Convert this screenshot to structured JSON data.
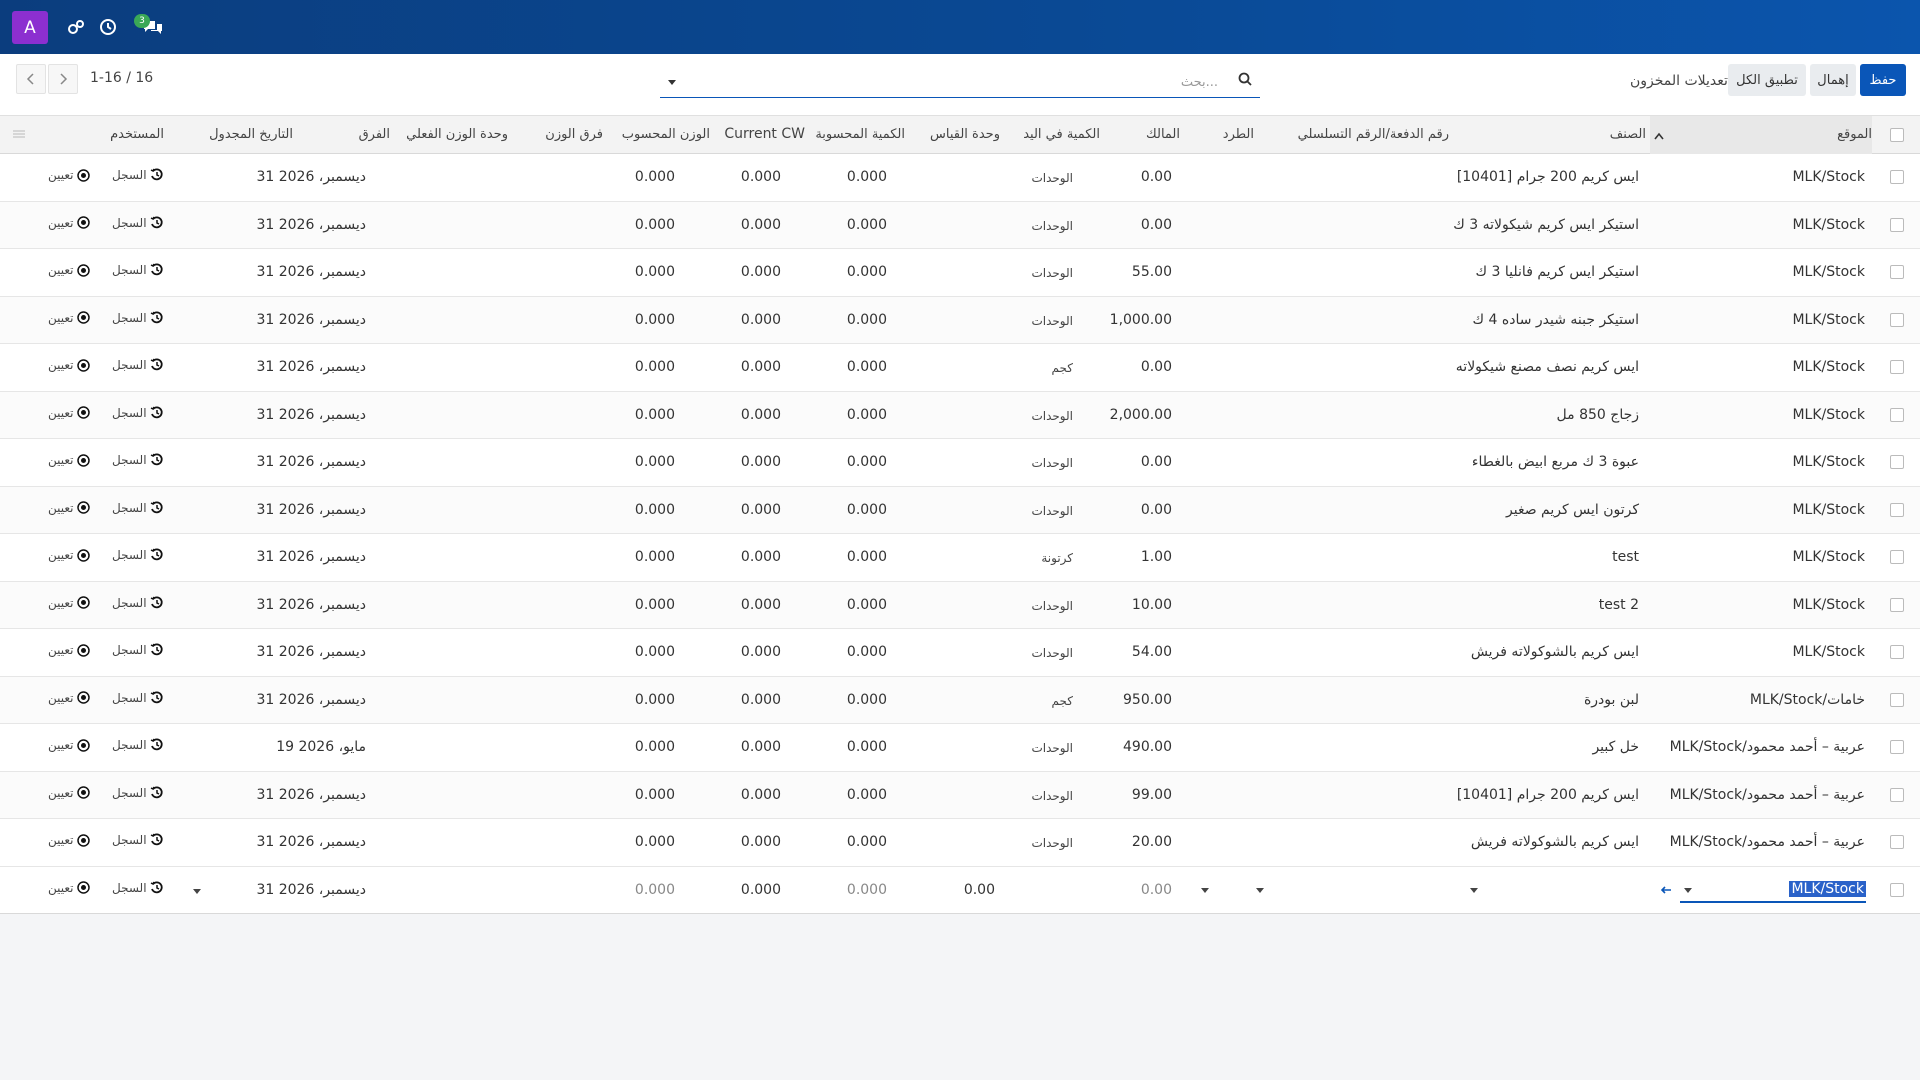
{
  "navbar": {
    "avatar_letter": "A",
    "messages_badge": "3",
    "icons": [
      "settings-cog-icon",
      "clock-icon",
      "chat-icon"
    ]
  },
  "control": {
    "save_label": "حفظ",
    "discard_label": "إهمال",
    "apply_all_label": "تطبيق الكل",
    "title": "تعديلات المخزون",
    "search_placeholder": "بحث...",
    "pager": "1-16 / 16"
  },
  "columns": {
    "location": "الموقع",
    "product": "الصنف",
    "lot": "رقم الدفعة/الرقم التسلسلي",
    "package": "الطرد",
    "owner": "المالك",
    "on_hand": "الكمية في اليد",
    "uom": "وحدة القياس",
    "counted": "الكمية المحسوبة",
    "current_cw": "Current CW",
    "computed_weight": "الوزن المحسوب",
    "weight_diff": "فرق الوزن",
    "actual_weight_uom": "وحدة الوزن الفعلي",
    "difference": "الفرق",
    "scheduled_date": "التاريخ المجدول",
    "user": "المستخدم"
  },
  "actions": {
    "history": "السجل",
    "set": "تعيين"
  },
  "rows": [
    {
      "location": "MLK/Stock",
      "product": "[10401] ايس كريم 200 جرام",
      "on_hand": "0.00",
      "uom": "الوحدات",
      "current_cw": "0.000",
      "computed_weight": "0.000",
      "weight_diff": "0.000",
      "date": "31 ديسمبر، 2026"
    },
    {
      "location": "MLK/Stock",
      "product": "استيكر ايس كريم شيكولاته 3 ك",
      "on_hand": "0.00",
      "uom": "الوحدات",
      "current_cw": "0.000",
      "computed_weight": "0.000",
      "weight_diff": "0.000",
      "date": "31 ديسمبر، 2026"
    },
    {
      "location": "MLK/Stock",
      "product": "استيكر ايس كريم فانليا 3 ك",
      "on_hand": "55.00",
      "uom": "الوحدات",
      "current_cw": "0.000",
      "computed_weight": "0.000",
      "weight_diff": "0.000",
      "date": "31 ديسمبر، 2026"
    },
    {
      "location": "MLK/Stock",
      "product": "استيكر جبنه شيدر ساده 4 ك",
      "on_hand": "1,000.00",
      "uom": "الوحدات",
      "current_cw": "0.000",
      "computed_weight": "0.000",
      "weight_diff": "0.000",
      "date": "31 ديسمبر، 2026"
    },
    {
      "location": "MLK/Stock",
      "product": "ايس كريم نصف مصنع شيكولاته",
      "on_hand": "0.00",
      "uom": "كجم",
      "current_cw": "0.000",
      "computed_weight": "0.000",
      "weight_diff": "0.000",
      "date": "31 ديسمبر، 2026"
    },
    {
      "location": "MLK/Stock",
      "product": "زجاج 850 مل",
      "on_hand": "2,000.00",
      "uom": "الوحدات",
      "current_cw": "0.000",
      "computed_weight": "0.000",
      "weight_diff": "0.000",
      "date": "31 ديسمبر، 2026"
    },
    {
      "location": "MLK/Stock",
      "product": "عبوة 3 ك مربع ابيض بالغطاء",
      "on_hand": "0.00",
      "uom": "الوحدات",
      "current_cw": "0.000",
      "computed_weight": "0.000",
      "weight_diff": "0.000",
      "date": "31 ديسمبر، 2026"
    },
    {
      "location": "MLK/Stock",
      "product": "كرتون ايس كريم صغير",
      "on_hand": "0.00",
      "uom": "الوحدات",
      "current_cw": "0.000",
      "computed_weight": "0.000",
      "weight_diff": "0.000",
      "date": "31 ديسمبر، 2026"
    },
    {
      "location": "MLK/Stock",
      "product": "test",
      "on_hand": "1.00",
      "uom": "كرتونة",
      "current_cw": "0.000",
      "computed_weight": "0.000",
      "weight_diff": "0.000",
      "date": "31 ديسمبر، 2026"
    },
    {
      "location": "MLK/Stock",
      "product": "test 2",
      "on_hand": "10.00",
      "uom": "الوحدات",
      "current_cw": "0.000",
      "computed_weight": "0.000",
      "weight_diff": "0.000",
      "date": "31 ديسمبر، 2026"
    },
    {
      "location": "MLK/Stock",
      "product": "ايس كريم بالشوكولاته فريش",
      "on_hand": "54.00",
      "uom": "الوحدات",
      "current_cw": "0.000",
      "computed_weight": "0.000",
      "weight_diff": "0.000",
      "date": "31 ديسمبر، 2026"
    },
    {
      "location": "MLK/Stock/خامات",
      "product": "لبن بودرة",
      "on_hand": "950.00",
      "uom": "كجم",
      "current_cw": "0.000",
      "computed_weight": "0.000",
      "weight_diff": "0.000",
      "date": "31 ديسمبر، 2026"
    },
    {
      "location": "MLK/Stock/عربية – أحمد محمود",
      "product": "خل كبير",
      "on_hand": "490.00",
      "uom": "الوحدات",
      "current_cw": "0.000",
      "computed_weight": "0.000",
      "weight_diff": "0.000",
      "date": "19 مايو، 2026"
    },
    {
      "location": "MLK/Stock/عربية – أحمد محمود",
      "product": "[10401] ايس كريم 200 جرام",
      "on_hand": "99.00",
      "uom": "الوحدات",
      "current_cw": "0.000",
      "computed_weight": "0.000",
      "weight_diff": "0.000",
      "date": "31 ديسمبر، 2026"
    },
    {
      "location": "MLK/Stock/عربية – أحمد محمود",
      "product": "ايس كريم بالشوكولاته فريش",
      "on_hand": "20.00",
      "uom": "الوحدات",
      "current_cw": "0.000",
      "computed_weight": "0.000",
      "weight_diff": "0.000",
      "date": "31 ديسمبر، 2026"
    }
  ],
  "edit_row": {
    "location": "MLK/Stock",
    "on_hand": "0.00",
    "counted": "0.00",
    "current_cw": "0.000",
    "computed_weight": "0.000",
    "weight_diff": "0.000",
    "date": "31 ديسمبر، 2026"
  }
}
